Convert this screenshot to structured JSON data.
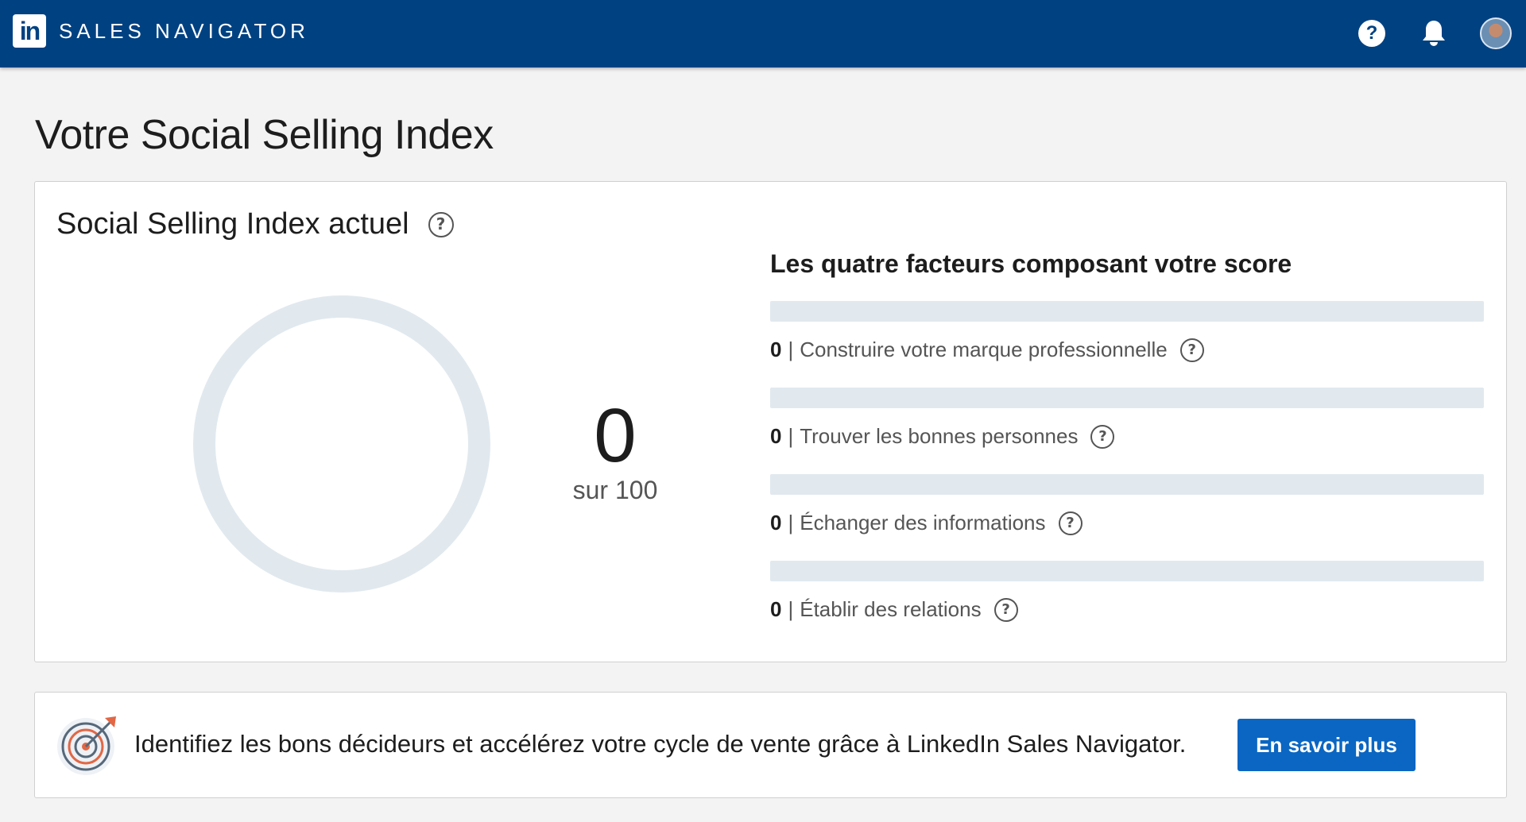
{
  "header": {
    "logo_text": "in",
    "brand_name": "SALES NAVIGATOR",
    "help_icon": "help-icon",
    "bell_icon": "bell-icon",
    "avatar_icon": "avatar",
    "bg_color": "#004182"
  },
  "page": {
    "title": "Votre Social Selling Index"
  },
  "ssi": {
    "card_title": "Social Selling Index actuel",
    "help_glyph": "?",
    "score": "0",
    "score_suffix": "sur 100",
    "score_value": 0,
    "score_max": 100,
    "factors_title": "Les quatre facteurs composant votre score",
    "separator": "|",
    "factors": [
      {
        "score": "0",
        "label": "Construire votre marque professionnelle",
        "fraction": 0
      },
      {
        "score": "0",
        "label": "Trouver les bonnes personnes",
        "fraction": 0
      },
      {
        "score": "0",
        "label": "Échanger des informations",
        "fraction": 0
      },
      {
        "score": "0",
        "label": "Établir des relations",
        "fraction": 0
      }
    ],
    "ring_color": "#e1e9ef",
    "accent_color": "#0a66c2"
  },
  "promo": {
    "icon": "target-icon",
    "text": "Identifiez les bons décideurs et accélérez votre cycle de vente grâce à LinkedIn Sales Navigator.",
    "button_label": "En savoir plus"
  }
}
